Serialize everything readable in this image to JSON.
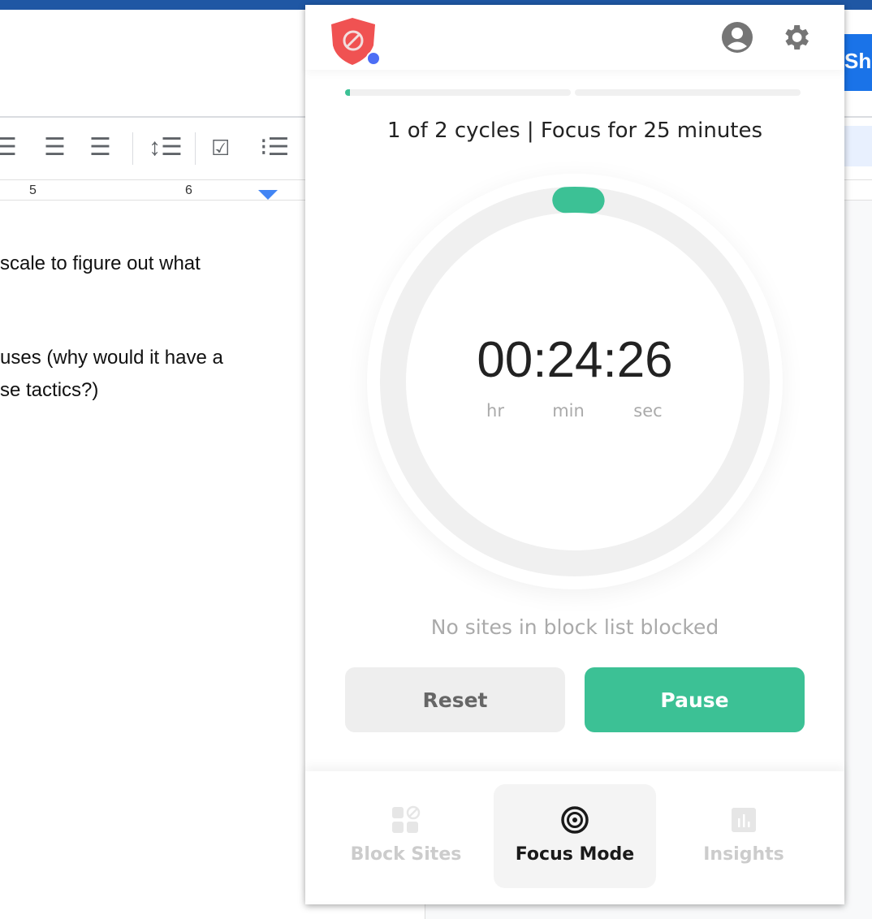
{
  "background_doc": {
    "ruler_numbers": [
      "5",
      "6"
    ],
    "lines": [
      "scale to figure out what",
      "uses (why would it have a",
      "se tactics?)"
    ],
    "share_label": "Sha"
  },
  "popup": {
    "header": {
      "logo_icon": "shield-block-icon",
      "profile_icon": "account-circle-icon",
      "settings_icon": "gear-icon"
    },
    "cycle_progress": [
      0.02,
      0
    ],
    "cycles_text": "1 of 2 cycles | Focus for 25 minutes",
    "timer": {
      "value": "00:24:26",
      "hr_label": "hr",
      "min_label": "min",
      "sec_label": "sec",
      "elapsed_fraction": 0.023
    },
    "status_text": "No sites in block list blocked",
    "reset_label": "Reset",
    "pause_label": "Pause",
    "nav": [
      {
        "label": "Block Sites",
        "icon": "block-sites-icon",
        "active": false
      },
      {
        "label": "Focus Mode",
        "icon": "target-icon",
        "active": true
      },
      {
        "label": "Insights",
        "icon": "chart-icon",
        "active": false
      }
    ],
    "colors": {
      "accent": "#3cc195",
      "logo_red": "#f05252",
      "dot_blue": "#4c6ef5"
    }
  }
}
